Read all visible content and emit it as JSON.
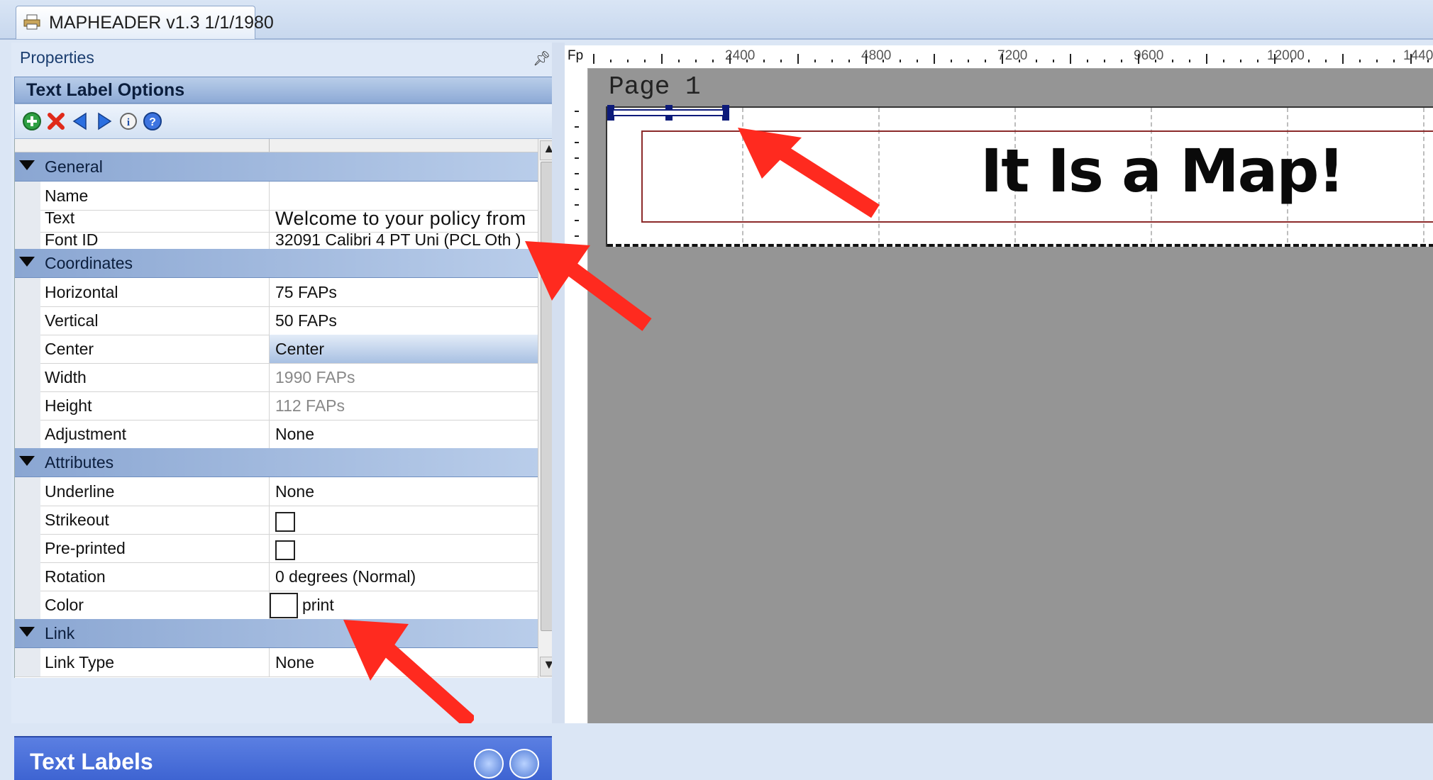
{
  "document_tab": {
    "title": "MAPHEADER v1.3 1/1/1980"
  },
  "properties_panel": {
    "title": "Properties",
    "header": "Text Label Options",
    "toolbar": [
      "add-icon",
      "delete-icon",
      "previous-icon",
      "next-icon",
      "info-icon",
      "help-icon"
    ],
    "categories": [
      {
        "label": "General",
        "rows": [
          {
            "name": "Name",
            "value": ""
          },
          {
            "name": "Text",
            "value": "Welcome to your policy from"
          },
          {
            "name": "Font ID",
            "value": "32091 Calibri 4 PT Uni (PCL Oth )"
          }
        ]
      },
      {
        "label": "Coordinates",
        "rows": [
          {
            "name": "Horizontal",
            "value": "75 FAPs"
          },
          {
            "name": "Vertical",
            "value": "50 FAPs"
          },
          {
            "name": "Center",
            "value": "Center"
          },
          {
            "name": "Width",
            "value": "1990 FAPs"
          },
          {
            "name": "Height",
            "value": "112 FAPs"
          },
          {
            "name": "Adjustment",
            "value": "None"
          }
        ]
      },
      {
        "label": "Attributes",
        "rows": [
          {
            "name": "Underline",
            "value": "None"
          },
          {
            "name": "Strikeout",
            "value": ""
          },
          {
            "name": "Pre-printed",
            "value": ""
          },
          {
            "name": "Rotation",
            "value": "0 degrees (Normal)"
          },
          {
            "name": "Color",
            "value": "print"
          }
        ]
      },
      {
        "label": "Link",
        "rows": [
          {
            "name": "Link Type",
            "value": "None"
          }
        ]
      }
    ]
  },
  "text_labels_panel": {
    "title": "Text Labels"
  },
  "canvas": {
    "ruler_label": "Fp",
    "ruler_numbers": [
      "2400",
      "4800",
      "7200",
      "9600",
      "12000",
      "1440"
    ],
    "page_label": "Page 1",
    "label_text": "It Is a Map!"
  },
  "colors": {
    "annotation_arrow": "#ff2a1f",
    "label_border": "#8c2a2a",
    "canvas_bg": "#959595"
  }
}
